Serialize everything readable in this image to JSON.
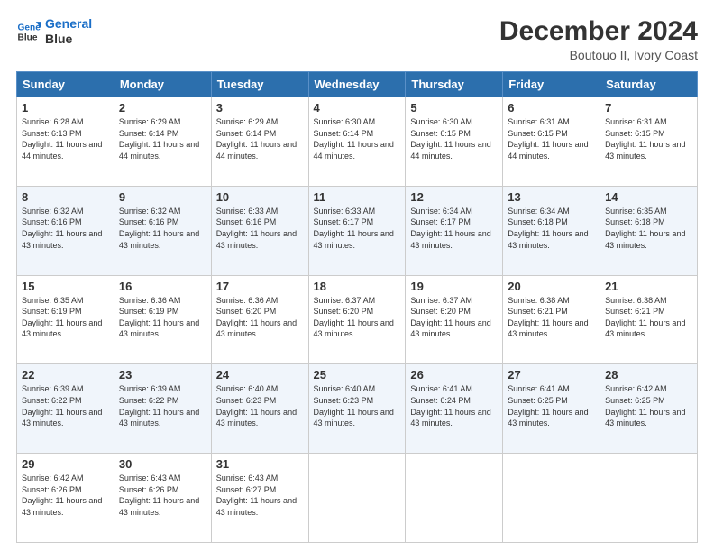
{
  "logo": {
    "line1": "General",
    "line2": "Blue"
  },
  "header": {
    "title": "December 2024",
    "subtitle": "Boutouo II, Ivory Coast"
  },
  "weekdays": [
    "Sunday",
    "Monday",
    "Tuesday",
    "Wednesday",
    "Thursday",
    "Friday",
    "Saturday"
  ],
  "weeks": [
    [
      {
        "day": "1",
        "sunrise": "Sunrise: 6:28 AM",
        "sunset": "Sunset: 6:13 PM",
        "daylight": "Daylight: 11 hours and 44 minutes."
      },
      {
        "day": "2",
        "sunrise": "Sunrise: 6:29 AM",
        "sunset": "Sunset: 6:14 PM",
        "daylight": "Daylight: 11 hours and 44 minutes."
      },
      {
        "day": "3",
        "sunrise": "Sunrise: 6:29 AM",
        "sunset": "Sunset: 6:14 PM",
        "daylight": "Daylight: 11 hours and 44 minutes."
      },
      {
        "day": "4",
        "sunrise": "Sunrise: 6:30 AM",
        "sunset": "Sunset: 6:14 PM",
        "daylight": "Daylight: 11 hours and 44 minutes."
      },
      {
        "day": "5",
        "sunrise": "Sunrise: 6:30 AM",
        "sunset": "Sunset: 6:15 PM",
        "daylight": "Daylight: 11 hours and 44 minutes."
      },
      {
        "day": "6",
        "sunrise": "Sunrise: 6:31 AM",
        "sunset": "Sunset: 6:15 PM",
        "daylight": "Daylight: 11 hours and 44 minutes."
      },
      {
        "day": "7",
        "sunrise": "Sunrise: 6:31 AM",
        "sunset": "Sunset: 6:15 PM",
        "daylight": "Daylight: 11 hours and 43 minutes."
      }
    ],
    [
      {
        "day": "8",
        "sunrise": "Sunrise: 6:32 AM",
        "sunset": "Sunset: 6:16 PM",
        "daylight": "Daylight: 11 hours and 43 minutes."
      },
      {
        "day": "9",
        "sunrise": "Sunrise: 6:32 AM",
        "sunset": "Sunset: 6:16 PM",
        "daylight": "Daylight: 11 hours and 43 minutes."
      },
      {
        "day": "10",
        "sunrise": "Sunrise: 6:33 AM",
        "sunset": "Sunset: 6:16 PM",
        "daylight": "Daylight: 11 hours and 43 minutes."
      },
      {
        "day": "11",
        "sunrise": "Sunrise: 6:33 AM",
        "sunset": "Sunset: 6:17 PM",
        "daylight": "Daylight: 11 hours and 43 minutes."
      },
      {
        "day": "12",
        "sunrise": "Sunrise: 6:34 AM",
        "sunset": "Sunset: 6:17 PM",
        "daylight": "Daylight: 11 hours and 43 minutes."
      },
      {
        "day": "13",
        "sunrise": "Sunrise: 6:34 AM",
        "sunset": "Sunset: 6:18 PM",
        "daylight": "Daylight: 11 hours and 43 minutes."
      },
      {
        "day": "14",
        "sunrise": "Sunrise: 6:35 AM",
        "sunset": "Sunset: 6:18 PM",
        "daylight": "Daylight: 11 hours and 43 minutes."
      }
    ],
    [
      {
        "day": "15",
        "sunrise": "Sunrise: 6:35 AM",
        "sunset": "Sunset: 6:19 PM",
        "daylight": "Daylight: 11 hours and 43 minutes."
      },
      {
        "day": "16",
        "sunrise": "Sunrise: 6:36 AM",
        "sunset": "Sunset: 6:19 PM",
        "daylight": "Daylight: 11 hours and 43 minutes."
      },
      {
        "day": "17",
        "sunrise": "Sunrise: 6:36 AM",
        "sunset": "Sunset: 6:20 PM",
        "daylight": "Daylight: 11 hours and 43 minutes."
      },
      {
        "day": "18",
        "sunrise": "Sunrise: 6:37 AM",
        "sunset": "Sunset: 6:20 PM",
        "daylight": "Daylight: 11 hours and 43 minutes."
      },
      {
        "day": "19",
        "sunrise": "Sunrise: 6:37 AM",
        "sunset": "Sunset: 6:20 PM",
        "daylight": "Daylight: 11 hours and 43 minutes."
      },
      {
        "day": "20",
        "sunrise": "Sunrise: 6:38 AM",
        "sunset": "Sunset: 6:21 PM",
        "daylight": "Daylight: 11 hours and 43 minutes."
      },
      {
        "day": "21",
        "sunrise": "Sunrise: 6:38 AM",
        "sunset": "Sunset: 6:21 PM",
        "daylight": "Daylight: 11 hours and 43 minutes."
      }
    ],
    [
      {
        "day": "22",
        "sunrise": "Sunrise: 6:39 AM",
        "sunset": "Sunset: 6:22 PM",
        "daylight": "Daylight: 11 hours and 43 minutes."
      },
      {
        "day": "23",
        "sunrise": "Sunrise: 6:39 AM",
        "sunset": "Sunset: 6:22 PM",
        "daylight": "Daylight: 11 hours and 43 minutes."
      },
      {
        "day": "24",
        "sunrise": "Sunrise: 6:40 AM",
        "sunset": "Sunset: 6:23 PM",
        "daylight": "Daylight: 11 hours and 43 minutes."
      },
      {
        "day": "25",
        "sunrise": "Sunrise: 6:40 AM",
        "sunset": "Sunset: 6:23 PM",
        "daylight": "Daylight: 11 hours and 43 minutes."
      },
      {
        "day": "26",
        "sunrise": "Sunrise: 6:41 AM",
        "sunset": "Sunset: 6:24 PM",
        "daylight": "Daylight: 11 hours and 43 minutes."
      },
      {
        "day": "27",
        "sunrise": "Sunrise: 6:41 AM",
        "sunset": "Sunset: 6:25 PM",
        "daylight": "Daylight: 11 hours and 43 minutes."
      },
      {
        "day": "28",
        "sunrise": "Sunrise: 6:42 AM",
        "sunset": "Sunset: 6:25 PM",
        "daylight": "Daylight: 11 hours and 43 minutes."
      }
    ],
    [
      {
        "day": "29",
        "sunrise": "Sunrise: 6:42 AM",
        "sunset": "Sunset: 6:26 PM",
        "daylight": "Daylight: 11 hours and 43 minutes."
      },
      {
        "day": "30",
        "sunrise": "Sunrise: 6:43 AM",
        "sunset": "Sunset: 6:26 PM",
        "daylight": "Daylight: 11 hours and 43 minutes."
      },
      {
        "day": "31",
        "sunrise": "Sunrise: 6:43 AM",
        "sunset": "Sunset: 6:27 PM",
        "daylight": "Daylight: 11 hours and 43 minutes."
      },
      null,
      null,
      null,
      null
    ]
  ]
}
